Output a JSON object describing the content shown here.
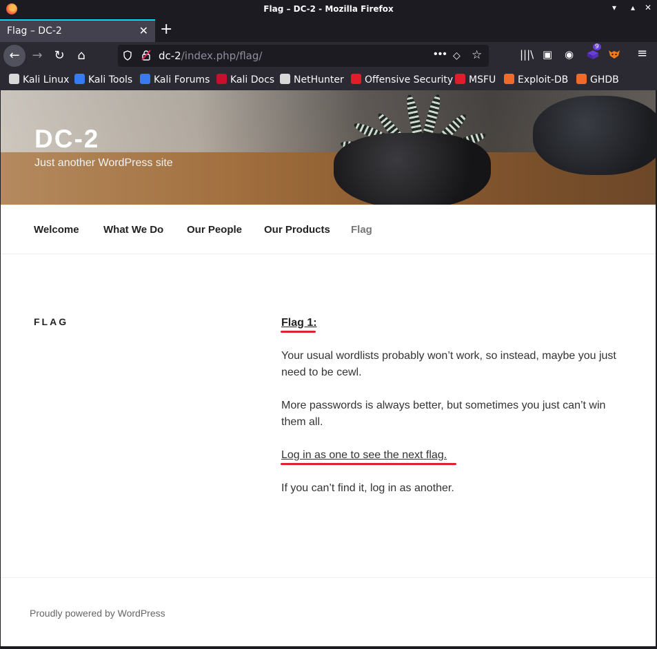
{
  "window": {
    "title": "Flag – DC-2 - Mozilla Firefox",
    "min_glyph": "▾",
    "max_glyph": "▴",
    "close_glyph": "✕"
  },
  "tabs": [
    {
      "title": "Flag – DC-2",
      "close_glyph": "✕"
    }
  ],
  "new_tab_glyph": "+",
  "nav": {
    "back_glyph": "←",
    "forward_glyph": "→",
    "reload_glyph": "↻",
    "home_glyph": "⌂"
  },
  "urlbar": {
    "host": "dc-2",
    "path": "/index.php/flag/",
    "dots_glyph": "•••",
    "pocket_glyph": "◇",
    "star_glyph": "☆"
  },
  "toolbar_icons": {
    "library_glyph": "|||\\",
    "sidebar_glyph": "▣",
    "account_glyph": "◉",
    "extension_badge": "9",
    "menu_glyph": "≡"
  },
  "bookmarks": [
    {
      "label": "Kali Linux",
      "icon_color": "#d8d8d8"
    },
    {
      "label": "Kali Tools",
      "icon_color": "#367bf0"
    },
    {
      "label": "Kali Forums",
      "icon_color": "#367bf0"
    },
    {
      "label": "Kali Docs",
      "icon_color": "#c8102e"
    },
    {
      "label": "NetHunter",
      "icon_color": "#d8d8d8"
    },
    {
      "label": "Offensive Security",
      "icon_color": "#e21d2b"
    },
    {
      "label": "MSFU",
      "icon_color": "#e21d2b"
    },
    {
      "label": "Exploit-DB",
      "icon_color": "#f06a2a"
    },
    {
      "label": "GHDB",
      "icon_color": "#f06a2a"
    }
  ],
  "site": {
    "title": "DC-2",
    "description": "Just another WordPress site"
  },
  "menu": [
    {
      "label": "Welcome",
      "current": false
    },
    {
      "label": "What We Do",
      "current": false
    },
    {
      "label": "Our People",
      "current": false
    },
    {
      "label": "Our Products",
      "current": false
    },
    {
      "label": "Flag",
      "current": true
    }
  ],
  "entry": {
    "label": "FLAG",
    "heading": "Flag 1:",
    "paragraphs": [
      "Your usual wordlists probably won’t work, so instead, maybe you just need to be cewl.",
      "More passwords is always better, but sometimes you just can’t win them all.",
      "Log in as one to see the next flag.",
      "If you can’t find it, log in as another."
    ]
  },
  "footer": {
    "credit": "Proudly powered by WordPress"
  },
  "colors": {
    "annotation_red": "#e0202a",
    "tab_accent": "#00ddff"
  }
}
